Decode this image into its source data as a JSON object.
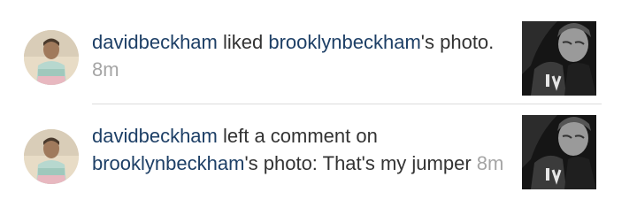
{
  "notifications": [
    {
      "username": "davidbeckham",
      "action": " liked ",
      "target": "brooklynbeckham",
      "suffix": "'s photo. ",
      "time": "8m",
      "avatar_icon": "user-avatar-photo",
      "thumb_icon": "photo-thumbnail"
    },
    {
      "username": "davidbeckham",
      "action": " left a comment on ",
      "target": "brooklynbeckham",
      "suffix": "'s photo: That's my jumper ",
      "time": "8m",
      "avatar_icon": "user-avatar-photo",
      "thumb_icon": "photo-thumbnail"
    }
  ],
  "colors": {
    "username": "#1d3f66",
    "text": "#333333",
    "timestamp": "#a5a5a5",
    "divider": "#dcdcdc",
    "background": "#ffffff"
  }
}
